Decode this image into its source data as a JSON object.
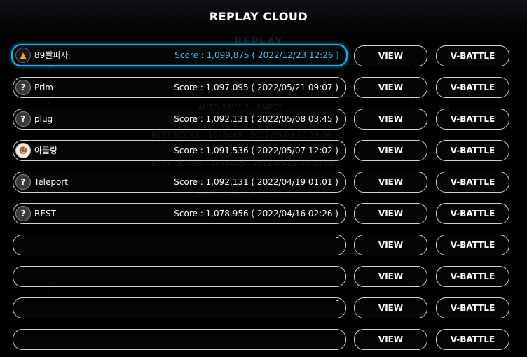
{
  "title": "REPLAY CLOUD",
  "background_ghost": {
    "title": "REPLAY",
    "lines": [
      "AUTO SAVE 1",
      "AUTO SAVE 2 - EMPTY",
      "BEST SCORE - 1076445 - 2022-05-02 00:03:06",
      "BEST COMBO - 1076445 - 2022-05-02 00:03:06",
      "BEST ACCURACY - EMPTY",
      "[1] - EMPTY",
      "[2] - EMPTY",
      "[3] - EMPTY",
      "REPLAY CLOUD",
      "VB"
    ]
  },
  "buttons": {
    "view": "VIEW",
    "vbattle": "V-BATTLE"
  },
  "entries": [
    {
      "name": "89쌀피자",
      "score": "Score : 1,099,875 ( 2022/12/23 12:26 )",
      "avatar": "pizza-icon",
      "active": true
    },
    {
      "name": "Prim",
      "score": "Score : 1,097,095 ( 2022/05/21 09:07 )",
      "avatar": "?"
    },
    {
      "name": "plug",
      "score": "Score : 1,092,131 ( 2022/05/08 03:45 )",
      "avatar": "?"
    },
    {
      "name": "아클랑",
      "score": "Score : 1,091,536 ( 2022/05/07 12:02 )",
      "avatar": "character-icon"
    },
    {
      "name": "Teleport",
      "score": "Score : 1,092,131 ( 2022/04/19 01:01 )",
      "avatar": "?"
    },
    {
      "name": "REST",
      "score": "Score : 1,078,956 ( 2022/04/16 02:26 )",
      "avatar": "?"
    },
    {
      "empty": "-"
    },
    {
      "empty": "-"
    },
    {
      "empty": "-"
    },
    {
      "empty": "-"
    }
  ],
  "colors": {
    "accent": "#1ab0f0",
    "active_score": "#36c2f5",
    "border": "#cfcfcf"
  }
}
